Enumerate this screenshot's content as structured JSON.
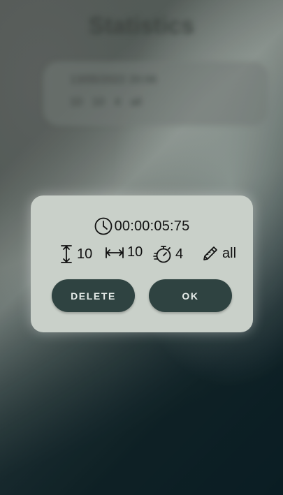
{
  "background": {
    "title": "Statistics",
    "card": {
      "date": "13/05/2022 20:06",
      "height": "10",
      "width": "10",
      "speed": "4",
      "tool": "all"
    }
  },
  "dialog": {
    "time_value": "00:00:05:75",
    "stats": {
      "height_value": "10",
      "width_value": "10",
      "speed_value": "4",
      "tool_value": "all"
    },
    "buttons": {
      "delete_label": "DELETE",
      "ok_label": "OK"
    }
  },
  "icons": {
    "time": "clock-icon",
    "height": "vertical-size-icon",
    "width": "horizontal-size-icon",
    "speed": "stopwatch-icon",
    "tool": "pencil-icon"
  },
  "colors": {
    "dialog_background": "#c9d0c9",
    "button_background": "#2f4341",
    "button_text": "#e6ece9"
  }
}
